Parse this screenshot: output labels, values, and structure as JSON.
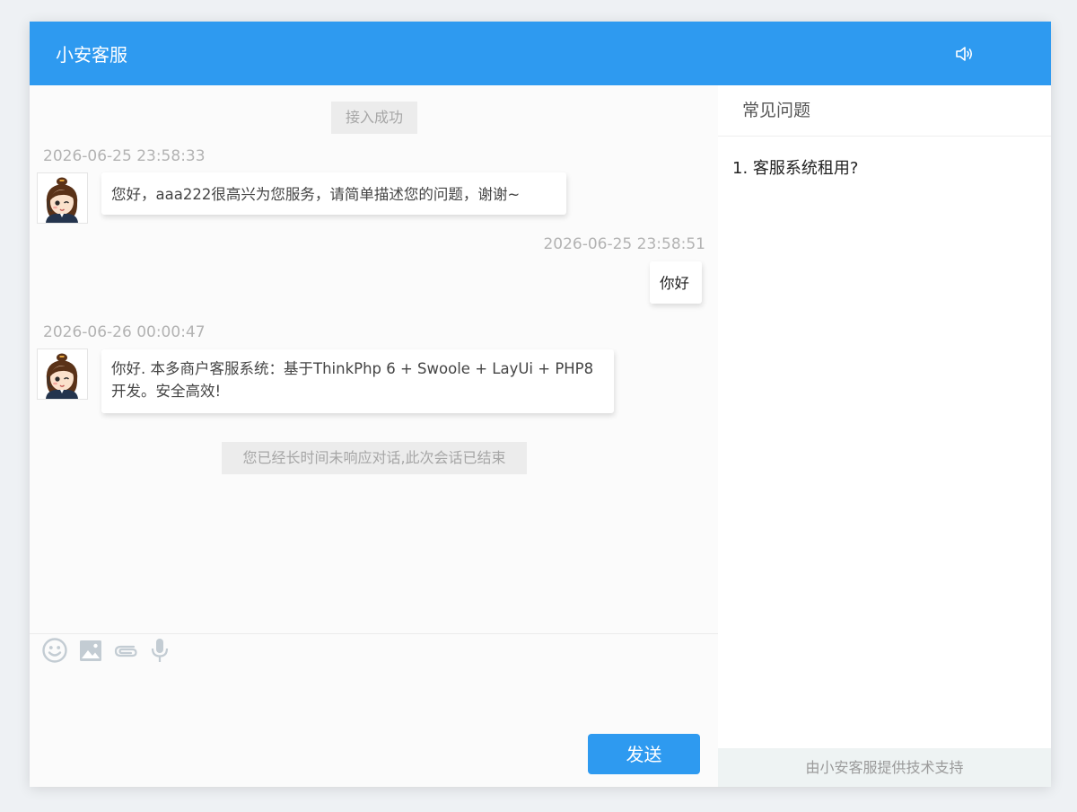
{
  "header": {
    "title": "小安客服",
    "sound_icon": "speaker-icon"
  },
  "chat": {
    "system_connected": "接入成功",
    "messages": [
      {
        "side": "left",
        "timestamp": "2026-06-25 23:58:33",
        "text": "您好，aaa222很高兴为您服务，请简单描述您的问题，谢谢~"
      },
      {
        "side": "right",
        "timestamp": "2026-06-25 23:58:51",
        "text": "你好"
      },
      {
        "side": "left",
        "timestamp": "2026-06-26 00:00:47",
        "text": "你好. 本多商户客服系统：基于ThinkPhp 6 + Swoole + LayUi + PHP8 开发。安全高效!"
      }
    ],
    "system_ended": "您已经长时间未响应对话,此次会话已结束"
  },
  "toolbar": {
    "icons": [
      "emoji-icon",
      "image-icon",
      "attachment-icon",
      "microphone-icon"
    ]
  },
  "input": {
    "value": ""
  },
  "send_button": {
    "label": "发送"
  },
  "sidebar": {
    "title": "常见问题",
    "faq": [
      "1. 客服系统租用?"
    ],
    "footer": "由小安客服提供技术支持"
  },
  "colors": {
    "primary": "#2e9af0",
    "icon_gray": "#c3ccd3"
  }
}
